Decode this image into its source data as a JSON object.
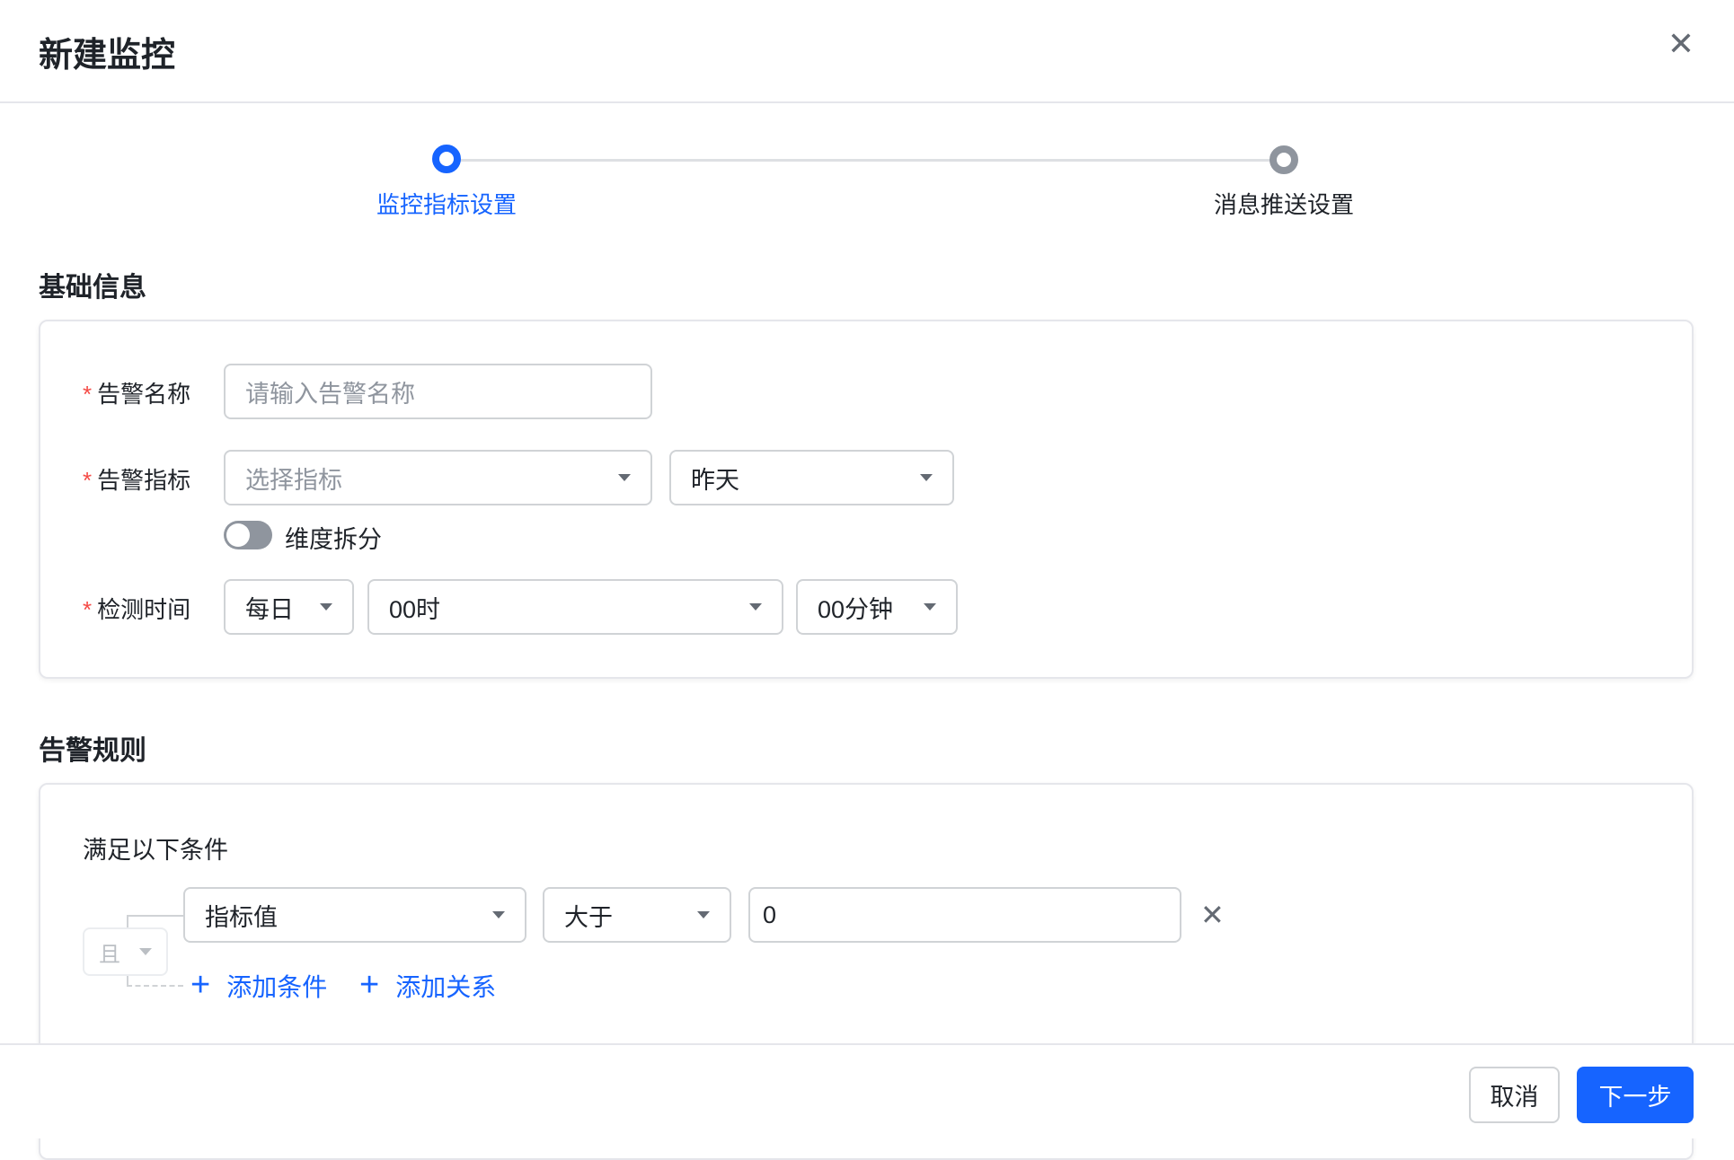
{
  "dialog": {
    "title": "新建监控",
    "close_icon": "close-icon"
  },
  "steps": [
    {
      "label": "监控指标设置",
      "active": true
    },
    {
      "label": "消息推送设置",
      "active": false
    }
  ],
  "basic": {
    "title": "基础信息",
    "name": {
      "label": "告警名称",
      "placeholder": "请输入告警名称",
      "value": ""
    },
    "metric": {
      "label": "告警指标",
      "placeholder": "选择指标",
      "period": "昨天"
    },
    "split": {
      "label": "维度拆分",
      "on": false
    },
    "time": {
      "label": "检测时间",
      "freq": "每日",
      "hour": "00时",
      "minute": "00分钟"
    }
  },
  "rules": {
    "title": "告警规则",
    "subtitle": "满足以下条件",
    "relation": "且",
    "condition": {
      "field": "指标值",
      "operator": "大于",
      "value": "0"
    },
    "add_condition": "添加条件",
    "add_relation": "添加关系"
  },
  "footer": {
    "cancel": "取消",
    "next": "下一步"
  },
  "colors": {
    "primary": "#1664ff",
    "required": "#f54a45"
  }
}
